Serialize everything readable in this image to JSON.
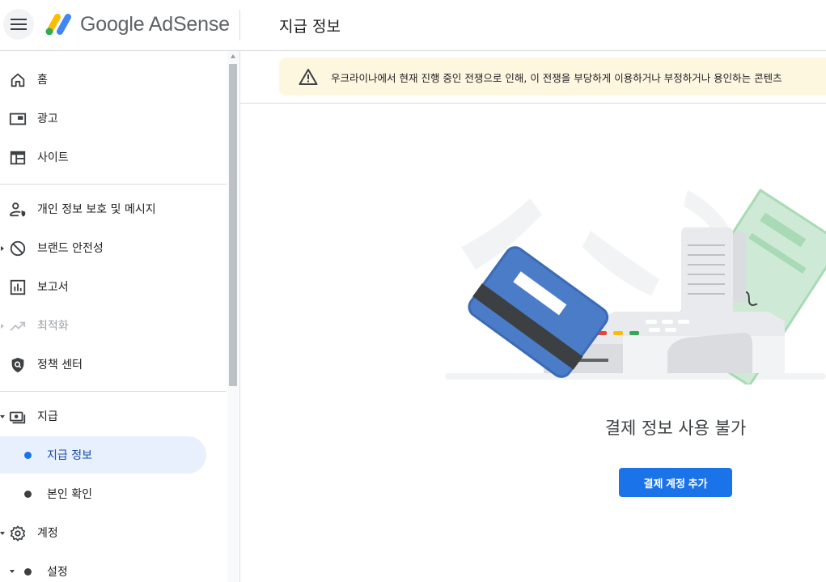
{
  "header": {
    "brand": "Google AdSense",
    "page_title": "지급 정보",
    "menu_icon": "hamburger-menu-icon",
    "logo_icon": "adsense-logo-icon"
  },
  "sidebar": {
    "items": [
      {
        "label": "홈",
        "icon": "home-icon"
      },
      {
        "label": "광고",
        "icon": "ads-icon"
      },
      {
        "label": "사이트",
        "icon": "sites-icon"
      },
      {
        "label": "개인 정보 보호 및 메시지",
        "icon": "privacy-messaging-icon"
      },
      {
        "label": "브랜드 안전성",
        "icon": "block-icon"
      },
      {
        "label": "보고서",
        "icon": "reports-icon"
      },
      {
        "label": "최적화",
        "icon": "trending-up-icon",
        "disabled": true
      },
      {
        "label": "정책 센터",
        "icon": "policy-shield-icon"
      },
      {
        "label": "지급",
        "icon": "payments-icon"
      },
      {
        "label": "계정",
        "icon": "gear-icon"
      }
    ],
    "payments_sub": [
      {
        "label": "지급 정보",
        "active": true
      },
      {
        "label": "본인 확인",
        "active": false
      }
    ],
    "account_sub": [
      {
        "label": "설정"
      }
    ]
  },
  "banner": {
    "icon": "warning-icon",
    "text": "우크라이나에서 현재 진행 중인 전쟁으로 인해, 이 전쟁을 부당하게 이용하거나 부정하거나 용인하는 콘텐츠"
  },
  "main": {
    "empty_title": "결제 정보 사용 불가",
    "add_button": "결제 계정 추가"
  },
  "colors": {
    "accent": "#1a73e8",
    "active_bg": "#e8f0fe",
    "banner_bg": "#fef7e0"
  }
}
